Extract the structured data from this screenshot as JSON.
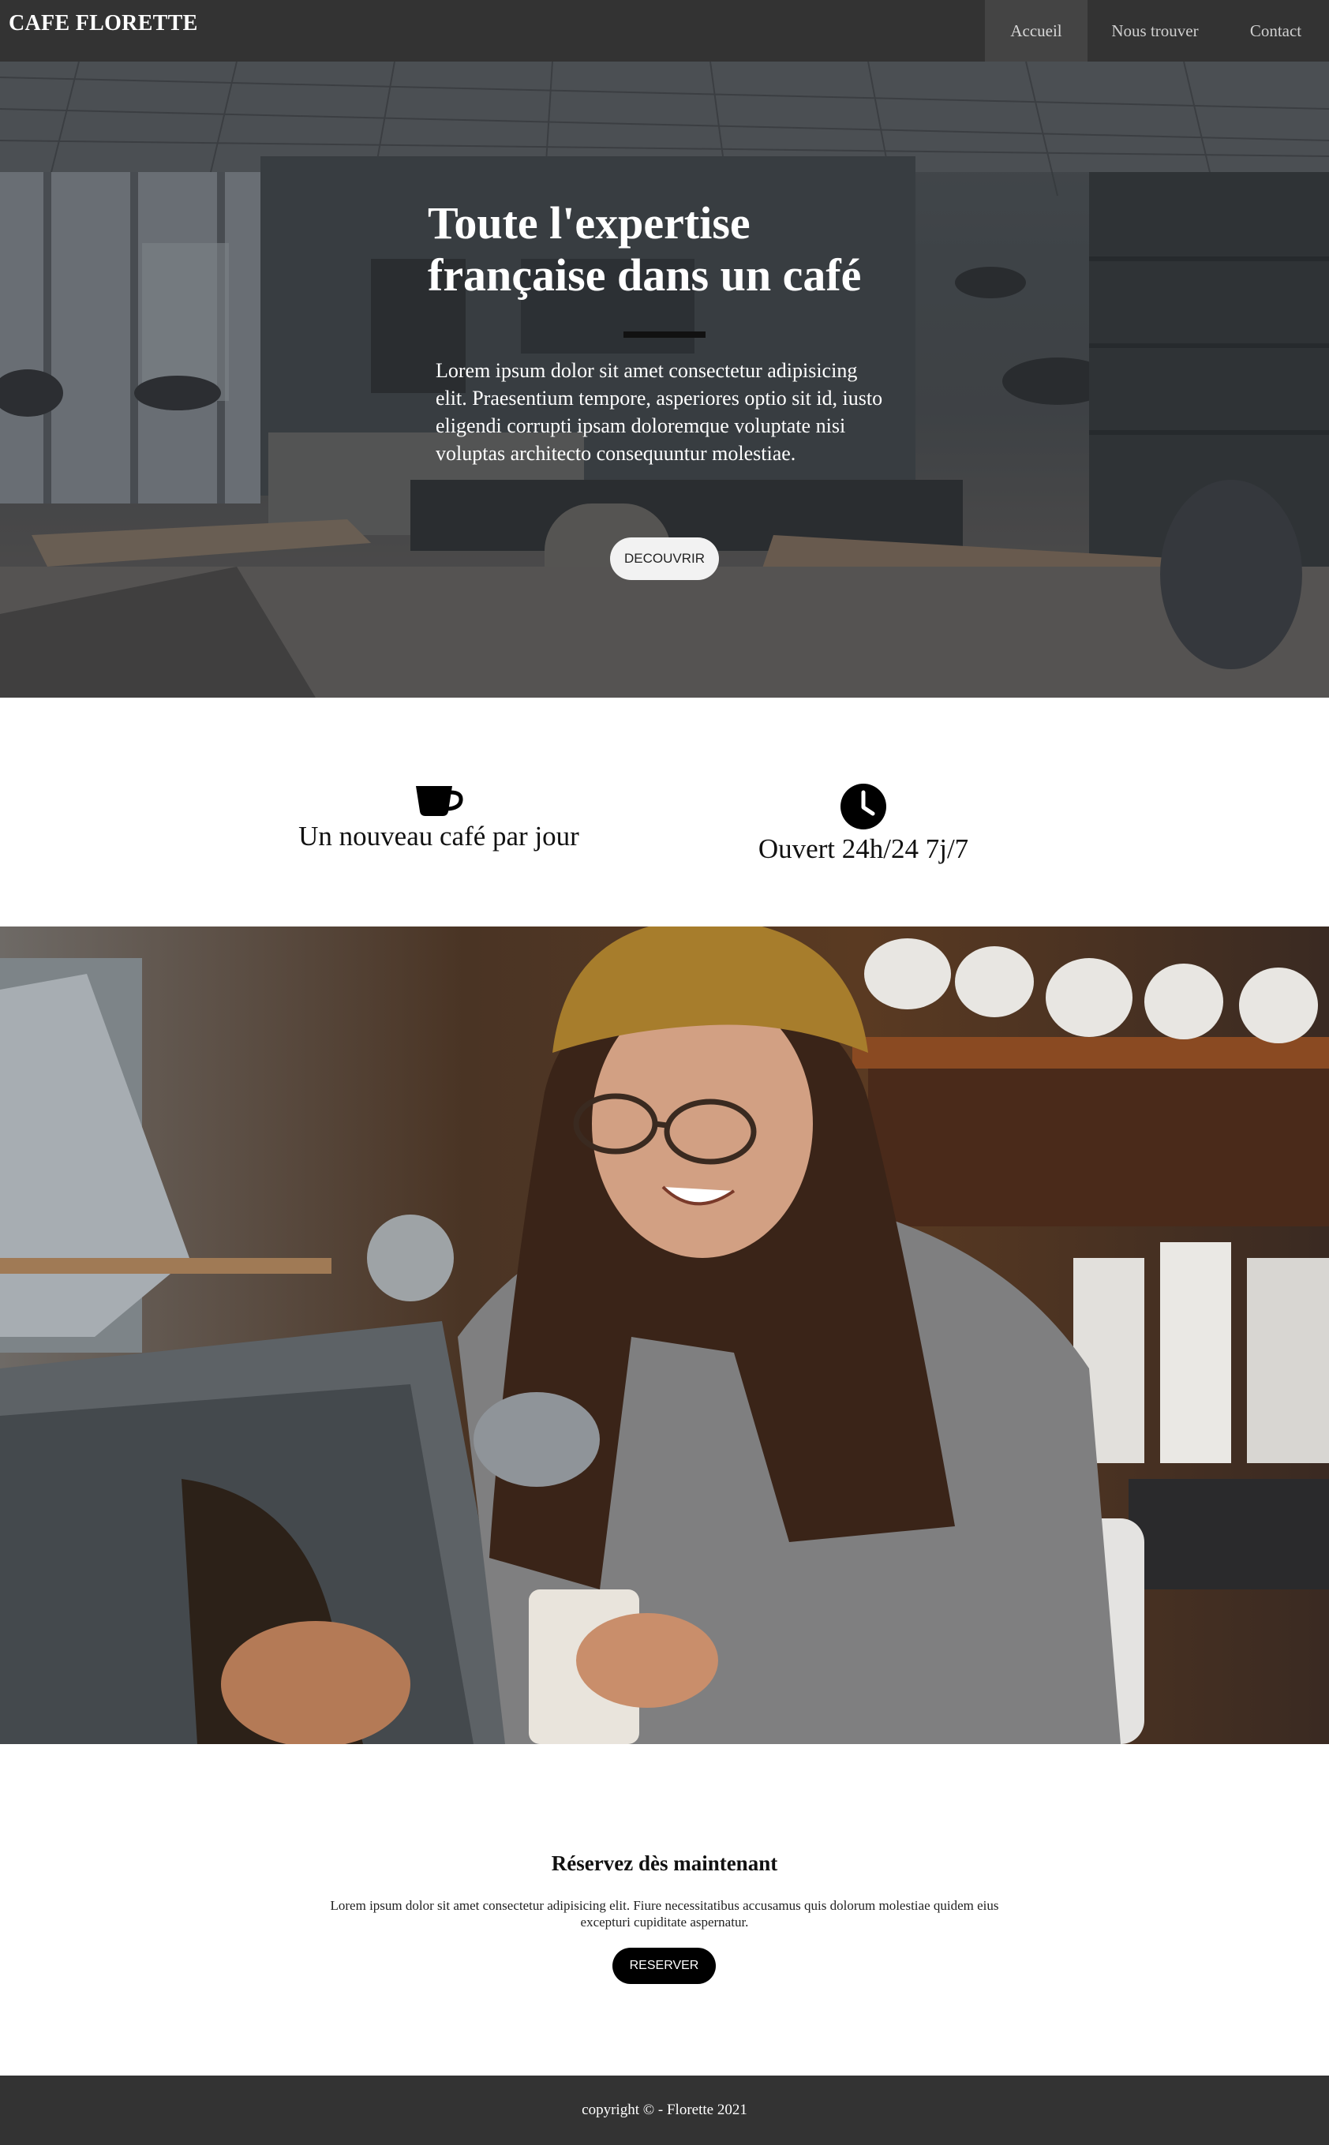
{
  "brand": {
    "name": "CAFE FLORETTE"
  },
  "nav": {
    "items": [
      {
        "label": "Accueil",
        "active": true
      },
      {
        "label": "Nous trouver",
        "active": false
      },
      {
        "label": "Contact",
        "active": false
      }
    ]
  },
  "hero": {
    "title": "Toute l'expertise française dans un café",
    "text": "Lorem ipsum dolor sit amet consectetur adipisicing elit. Praesentium tempore, asperiores optio sit id, iusto eligendi corrupti ipsam doloremque voluptate nisi voluptas architecto consequuntur molestiae.",
    "button_label": "DECOUVRIR"
  },
  "features": [
    {
      "icon": "coffee-cup-icon",
      "label": "Un nouveau café par jour"
    },
    {
      "icon": "clock-icon",
      "label": "Ouvert 24h/24 7j/7"
    }
  ],
  "reservation": {
    "title": "Réservez dès maintenant",
    "text": "Lorem ipsum dolor sit amet consectetur adipisicing elit. Fiure necessitatibus accusamus quis dolorum molestiae quidem eius excepturi cupiditate aspernatur.",
    "button_label": "RESERVER"
  },
  "footer": {
    "text": "copyright © - Florette 2021"
  },
  "colors": {
    "navbar": "#333333",
    "nav_active": "#444444",
    "footer": "#333333",
    "reserve_button": "#000000"
  }
}
